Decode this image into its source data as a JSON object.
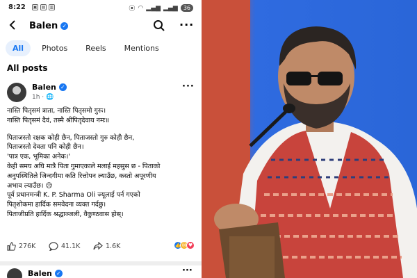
{
  "status": {
    "time": "8:22",
    "battery": "36",
    "left_icons": [
      "notification-icon",
      "gallery-icon",
      "sim-icon"
    ]
  },
  "header": {
    "name": "Balen"
  },
  "tabs": [
    {
      "label": "All",
      "active": true
    },
    {
      "label": "Photos",
      "active": false
    },
    {
      "label": "Reels",
      "active": false
    },
    {
      "label": "Mentions",
      "active": false
    }
  ],
  "section_title": "All posts",
  "post": {
    "author": "Balen",
    "time": "1h · ",
    "lines": [
      "नास्ति पितृसमं त्राता, नास्ति पितृसमो गुरुः।",
      "नास्ति पितृसमं दैवं, तस्मै श्रीपितृदेवाय नमः॥",
      "",
      "पिताजस्तो रक्षक कोही छैन, पिताजस्तो गुरु कोही छैन,",
      "पिताजस्तो देवता पनि कोही छैन।",
      "'पात्र एक, भूमिका अनेक।'",
      "केही समय अघि मात्रै पिता गुमाएकाले मलाई महसुस छ - पिताको",
      "अनुपस्थितिले जिन्दगीमा कति रित्तोपन ल्याउँछ, कस्तो अपूरणीय",
      "अभाव ल्याउँछ। 😥",
      "पूर्व प्रधानमन्त्री K. P. Sharma Oli ज्यूलाई पर्न गएको",
      "पितृशोकमा हार्दिक समवेदना व्यक्त गर्दछु।",
      "पिताजीप्रति हार्दिक श्रद्धाञ्जली, वैकुण्ठवास होस्।"
    ],
    "likes": "276K",
    "comments": "41.1K",
    "shares": "1.6K",
    "reaction_icons": [
      "like-reaction-icon",
      "sad-reaction-icon",
      "love-reaction-icon"
    ]
  },
  "next_post": {
    "author": "Balen"
  },
  "colors": {
    "accent": "#1877f2",
    "tab_active_bg": "#e7f0fd",
    "photo_bg_red": "#c9503a",
    "photo_bg_blue": "#2a66d8",
    "vest_red": "#c8443c"
  }
}
